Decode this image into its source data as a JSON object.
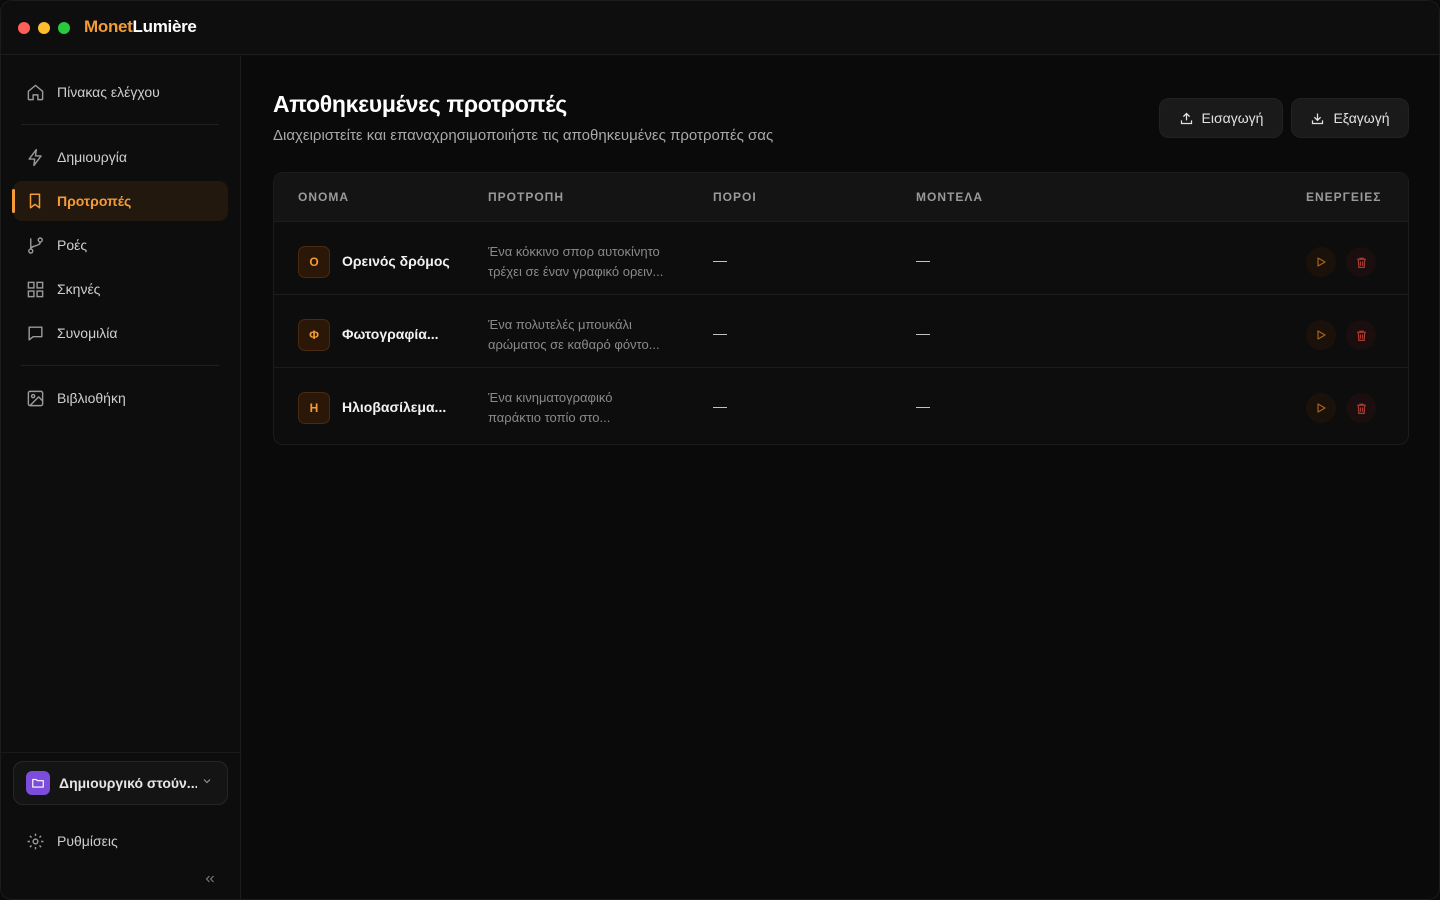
{
  "app": {
    "brand_part1": "Monet",
    "brand_part2": "Lumière"
  },
  "sidebar": {
    "items": [
      {
        "label": "Πίνακας ελέγχου",
        "icon": "home-icon"
      },
      {
        "label": "Δημιουργία",
        "icon": "lightning-icon"
      },
      {
        "label": "Προτροπές",
        "icon": "bookmark-icon",
        "active": true
      },
      {
        "label": "Ροές",
        "icon": "git-branch-icon"
      },
      {
        "label": "Σκηνές",
        "icon": "grid-icon"
      },
      {
        "label": "Συνομιλία",
        "icon": "chat-icon"
      },
      {
        "label": "Βιβλιοθήκη",
        "icon": "image-icon"
      }
    ],
    "workspace": {
      "name": "Δημιουργικό στούν...",
      "icon": "folder-icon"
    },
    "settings_label": "Ρυθμίσεις"
  },
  "main": {
    "title": "Αποθηκευμένες προτροπές",
    "subtitle": "Διαχειριστείτε και επαναχρησιμοποιήστε τις αποθηκευμένες προτροπές σας",
    "import_label": "Εισαγωγή",
    "export_label": "Εξαγωγή",
    "table": {
      "columns": [
        "ΟΝΟΜΑ",
        "ΠΡΟΤΡΟΠΗ",
        "ΠΟΡΟΙ",
        "ΜΟΝΤΕΛΑ",
        "ΕΝΕΡΓΕΙΕΣ"
      ],
      "rows": [
        {
          "initial": "Ο",
          "name": "Ορεινός δρόμος",
          "prompt_line1": "Ένα κόκκινο σπορ αυτοκίνητο",
          "prompt_line2": "τρέχει σε έναν γραφικό ορειν...",
          "resources": "—",
          "models": "—"
        },
        {
          "initial": "Φ",
          "name": "Φωτογραφία...",
          "prompt_line1": "Ένα πολυτελές μπουκάλι",
          "prompt_line2": "αρώματος σε καθαρό φόντο...",
          "resources": "—",
          "models": "—"
        },
        {
          "initial": "Η",
          "name": "Ηλιοβασίλεμα...",
          "prompt_line1": "Ένα κινηματογραφικό",
          "prompt_line2": "παράκτιο τοπίο στο...",
          "resources": "—",
          "models": "—"
        }
      ]
    }
  },
  "colors": {
    "accent": "#f39c38",
    "workspace": "#7c4ddb",
    "delete": "#c0392b"
  }
}
